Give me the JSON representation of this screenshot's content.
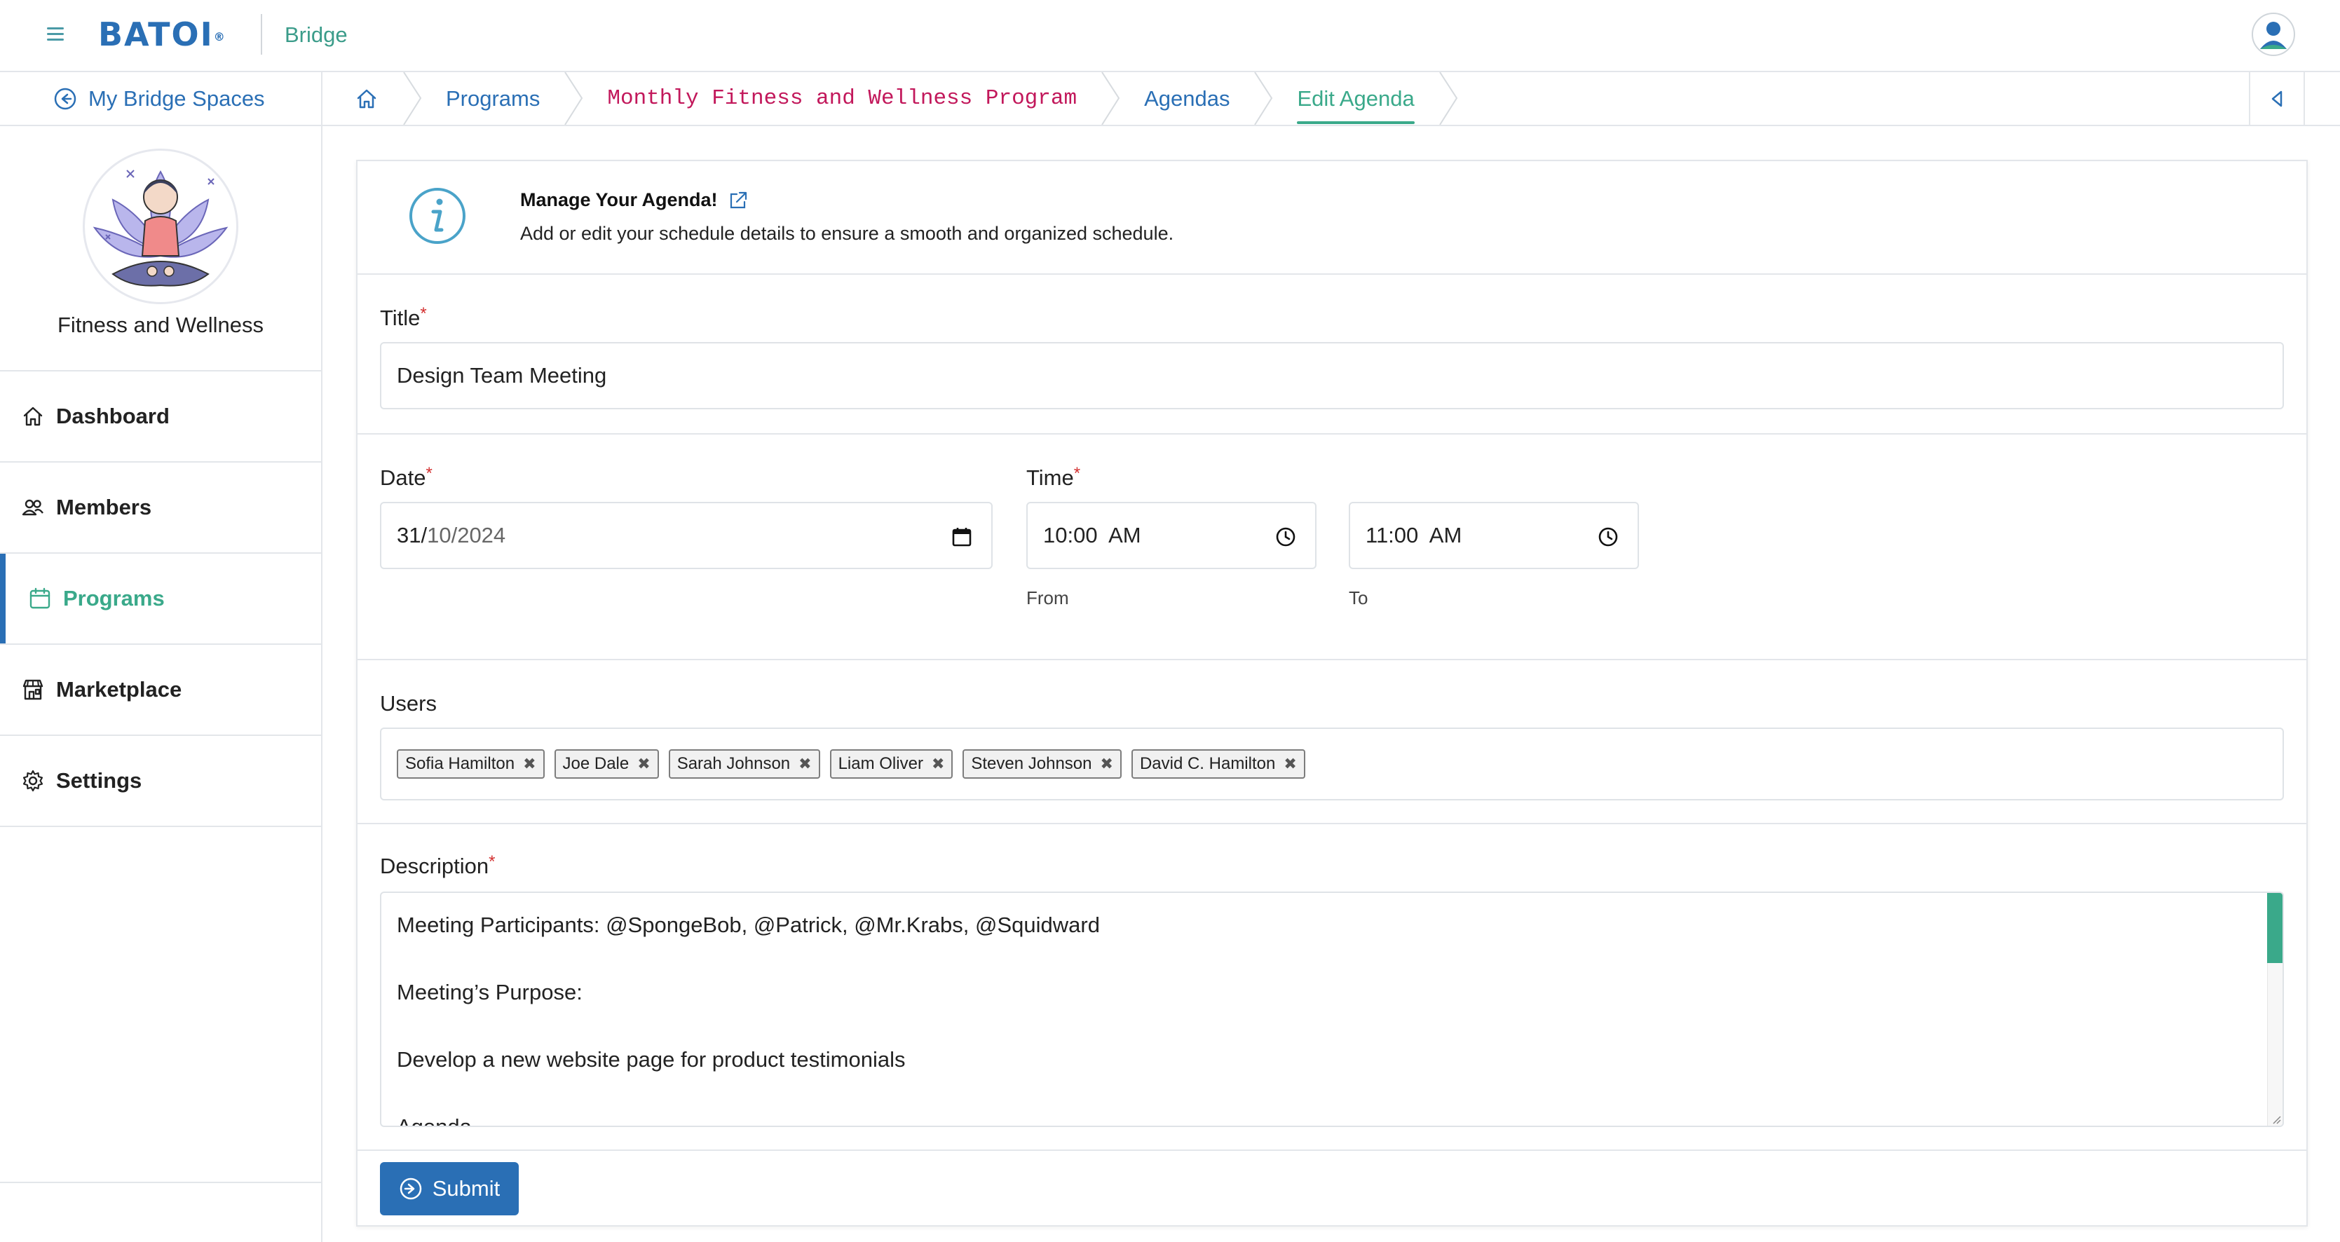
{
  "header": {
    "logo_text": "BATOI",
    "logo_mark": "®",
    "app_name": "Bridge"
  },
  "breadcrumb": {
    "back_label": "My Bridge Spaces",
    "items": [
      {
        "label": "Programs"
      },
      {
        "label": "Monthly Fitness and Wellness Program"
      },
      {
        "label": "Agendas"
      },
      {
        "label": "Edit Agenda"
      }
    ]
  },
  "sidebar": {
    "space_name": "Fitness and Wellness",
    "items": [
      {
        "label": "Dashboard",
        "icon": "home-icon"
      },
      {
        "label": "Members",
        "icon": "users-icon"
      },
      {
        "label": "Programs",
        "icon": "calendar-icon",
        "active": true
      },
      {
        "label": "Marketplace",
        "icon": "store-icon"
      },
      {
        "label": "Settings",
        "icon": "gear-icon"
      }
    ]
  },
  "info": {
    "title": "Manage Your Agenda!",
    "subtitle": "Add or edit your schedule details to ensure a smooth and organized schedule."
  },
  "form": {
    "title_label": "Title",
    "title_value": "Design Team Meeting",
    "date_label": "Date",
    "date_day": "31/",
    "date_rest": "10/2024",
    "time_label": "Time",
    "time_from": "10:00  AM",
    "time_to": "11:00  AM",
    "from_hint": "From",
    "to_hint": "To",
    "users_label": "Users",
    "users": [
      "Sofia Hamilton",
      "Joe Dale",
      "Sarah Johnson",
      "Liam Oliver",
      "Steven Johnson",
      "David C. Hamilton"
    ],
    "description_label": "Description",
    "description_lines": [
      "Meeting Participants: @SpongeBob, @Patrick, @Mr.Krabs, @Squidward",
      "Meeting’s Purpose:",
      "Develop a new website page for product testimonials",
      "Agenda"
    ],
    "required_mark": "*",
    "submit_label": "Submit"
  },
  "colors": {
    "primary": "#2a6fb5",
    "accent": "#3aa98a",
    "breadcrumb_program": "#c2185b",
    "required": "#d32f2f"
  }
}
